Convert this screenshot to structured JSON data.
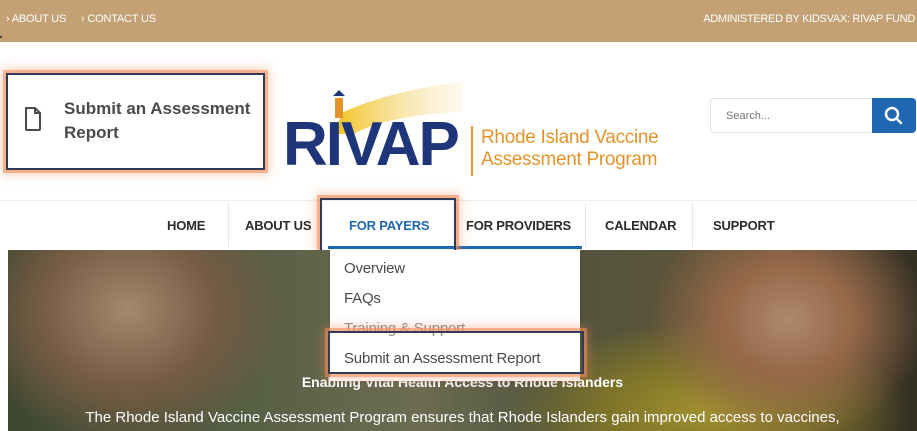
{
  "topbar": {
    "links": [
      "ABOUT US",
      "CONTACT US"
    ],
    "admin": "ADMINISTERED BY KIDSVAX: RIVAP FUND"
  },
  "submit_box": {
    "label": "Submit an Assessment Report",
    "icon": "document-icon"
  },
  "logo": {
    "wordmark": "RIVAP",
    "tagline_1": "Rhode Island Vaccine",
    "tagline_2": "Assessment Program"
  },
  "search": {
    "placeholder": "Search...",
    "icon": "search-icon"
  },
  "nav": {
    "items": [
      "HOME",
      "ABOUT US",
      "FOR PAYERS",
      "FOR PROVIDERS",
      "CALENDAR",
      "SUPPORT"
    ],
    "active": "FOR PAYERS"
  },
  "dropdown": {
    "items": [
      "Overview",
      "FAQs",
      "Training & Support",
      "Submit an Assessment Report"
    ]
  },
  "hero": {
    "headline": "Enabling Vital Health Access to Rhode Islanders",
    "body": "The Rhode Island  Vaccine Assessment Program ensures that Rhode Islanders gain improved access to vaccines,"
  },
  "colors": {
    "topbar": "#c4a174",
    "brand_blue": "#1e3679",
    "accent_blue": "#1f67b1",
    "brand_orange": "#e4932a",
    "highlight": "#f28c5a"
  }
}
